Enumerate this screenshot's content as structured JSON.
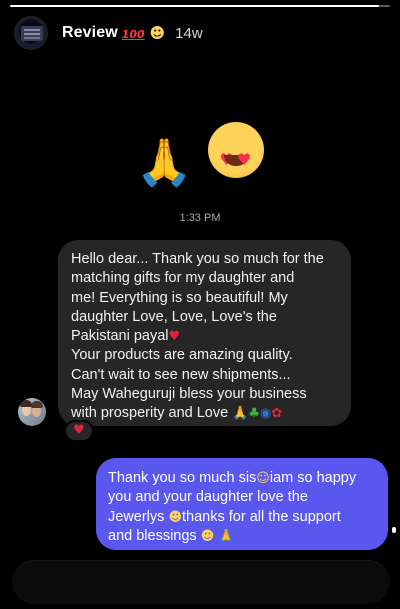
{
  "story": {
    "progress": 0.97,
    "title": "Review",
    "title_emojis": [
      "100-icon",
      "heart-eyes-icon"
    ],
    "time_ago": "14w"
  },
  "big_emojis": [
    "folded-hands-icon",
    "heart-eyes-icon"
  ],
  "timestamp": "1:33 PM",
  "received": {
    "lines": [
      "Hello dear... Thank you so much for the",
      "matching gifts for my daughter and",
      "me! Everything is so beautiful! My",
      "daughter Love, Love, Love's the",
      "Pakistani payal",
      "Your products are amazing quality.",
      "Can't wait to see new shipments...",
      "May Waheguruji bless your business",
      "with prosperity and Love"
    ],
    "reaction": "heart-icon"
  },
  "sent": {
    "lines": [
      "Thank you so much sis",
      "iam so happy",
      "you and your daughter love the",
      "Jewerlys",
      "thanks for all the support",
      "and blessings"
    ]
  },
  "colors": {
    "background": "#000000",
    "received_bubble": "#262626",
    "sent_bubble": "#5a57ef",
    "heart": "#e0243a"
  }
}
